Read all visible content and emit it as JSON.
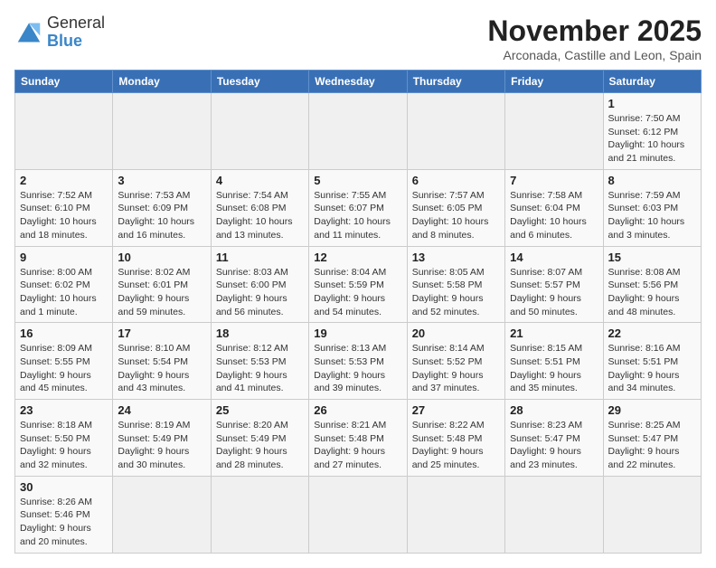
{
  "logo": {
    "line1": "General",
    "line2": "Blue"
  },
  "title": "November 2025",
  "subtitle": "Arconada, Castille and Leon, Spain",
  "weekdays": [
    "Sunday",
    "Monday",
    "Tuesday",
    "Wednesday",
    "Thursday",
    "Friday",
    "Saturday"
  ],
  "weeks": [
    [
      {
        "day": "",
        "info": ""
      },
      {
        "day": "",
        "info": ""
      },
      {
        "day": "",
        "info": ""
      },
      {
        "day": "",
        "info": ""
      },
      {
        "day": "",
        "info": ""
      },
      {
        "day": "",
        "info": ""
      },
      {
        "day": "1",
        "info": "Sunrise: 7:50 AM\nSunset: 6:12 PM\nDaylight: 10 hours and 21 minutes."
      }
    ],
    [
      {
        "day": "2",
        "info": "Sunrise: 7:52 AM\nSunset: 6:10 PM\nDaylight: 10 hours and 18 minutes."
      },
      {
        "day": "3",
        "info": "Sunrise: 7:53 AM\nSunset: 6:09 PM\nDaylight: 10 hours and 16 minutes."
      },
      {
        "day": "4",
        "info": "Sunrise: 7:54 AM\nSunset: 6:08 PM\nDaylight: 10 hours and 13 minutes."
      },
      {
        "day": "5",
        "info": "Sunrise: 7:55 AM\nSunset: 6:07 PM\nDaylight: 10 hours and 11 minutes."
      },
      {
        "day": "6",
        "info": "Sunrise: 7:57 AM\nSunset: 6:05 PM\nDaylight: 10 hours and 8 minutes."
      },
      {
        "day": "7",
        "info": "Sunrise: 7:58 AM\nSunset: 6:04 PM\nDaylight: 10 hours and 6 minutes."
      },
      {
        "day": "8",
        "info": "Sunrise: 7:59 AM\nSunset: 6:03 PM\nDaylight: 10 hours and 3 minutes."
      }
    ],
    [
      {
        "day": "9",
        "info": "Sunrise: 8:00 AM\nSunset: 6:02 PM\nDaylight: 10 hours and 1 minute."
      },
      {
        "day": "10",
        "info": "Sunrise: 8:02 AM\nSunset: 6:01 PM\nDaylight: 9 hours and 59 minutes."
      },
      {
        "day": "11",
        "info": "Sunrise: 8:03 AM\nSunset: 6:00 PM\nDaylight: 9 hours and 56 minutes."
      },
      {
        "day": "12",
        "info": "Sunrise: 8:04 AM\nSunset: 5:59 PM\nDaylight: 9 hours and 54 minutes."
      },
      {
        "day": "13",
        "info": "Sunrise: 8:05 AM\nSunset: 5:58 PM\nDaylight: 9 hours and 52 minutes."
      },
      {
        "day": "14",
        "info": "Sunrise: 8:07 AM\nSunset: 5:57 PM\nDaylight: 9 hours and 50 minutes."
      },
      {
        "day": "15",
        "info": "Sunrise: 8:08 AM\nSunset: 5:56 PM\nDaylight: 9 hours and 48 minutes."
      }
    ],
    [
      {
        "day": "16",
        "info": "Sunrise: 8:09 AM\nSunset: 5:55 PM\nDaylight: 9 hours and 45 minutes."
      },
      {
        "day": "17",
        "info": "Sunrise: 8:10 AM\nSunset: 5:54 PM\nDaylight: 9 hours and 43 minutes."
      },
      {
        "day": "18",
        "info": "Sunrise: 8:12 AM\nSunset: 5:53 PM\nDaylight: 9 hours and 41 minutes."
      },
      {
        "day": "19",
        "info": "Sunrise: 8:13 AM\nSunset: 5:53 PM\nDaylight: 9 hours and 39 minutes."
      },
      {
        "day": "20",
        "info": "Sunrise: 8:14 AM\nSunset: 5:52 PM\nDaylight: 9 hours and 37 minutes."
      },
      {
        "day": "21",
        "info": "Sunrise: 8:15 AM\nSunset: 5:51 PM\nDaylight: 9 hours and 35 minutes."
      },
      {
        "day": "22",
        "info": "Sunrise: 8:16 AM\nSunset: 5:51 PM\nDaylight: 9 hours and 34 minutes."
      }
    ],
    [
      {
        "day": "23",
        "info": "Sunrise: 8:18 AM\nSunset: 5:50 PM\nDaylight: 9 hours and 32 minutes."
      },
      {
        "day": "24",
        "info": "Sunrise: 8:19 AM\nSunset: 5:49 PM\nDaylight: 9 hours and 30 minutes."
      },
      {
        "day": "25",
        "info": "Sunrise: 8:20 AM\nSunset: 5:49 PM\nDaylight: 9 hours and 28 minutes."
      },
      {
        "day": "26",
        "info": "Sunrise: 8:21 AM\nSunset: 5:48 PM\nDaylight: 9 hours and 27 minutes."
      },
      {
        "day": "27",
        "info": "Sunrise: 8:22 AM\nSunset: 5:48 PM\nDaylight: 9 hours and 25 minutes."
      },
      {
        "day": "28",
        "info": "Sunrise: 8:23 AM\nSunset: 5:47 PM\nDaylight: 9 hours and 23 minutes."
      },
      {
        "day": "29",
        "info": "Sunrise: 8:25 AM\nSunset: 5:47 PM\nDaylight: 9 hours and 22 minutes."
      }
    ],
    [
      {
        "day": "30",
        "info": "Sunrise: 8:26 AM\nSunset: 5:46 PM\nDaylight: 9 hours and 20 minutes."
      },
      {
        "day": "",
        "info": ""
      },
      {
        "day": "",
        "info": ""
      },
      {
        "day": "",
        "info": ""
      },
      {
        "day": "",
        "info": ""
      },
      {
        "day": "",
        "info": ""
      },
      {
        "day": "",
        "info": ""
      }
    ]
  ]
}
